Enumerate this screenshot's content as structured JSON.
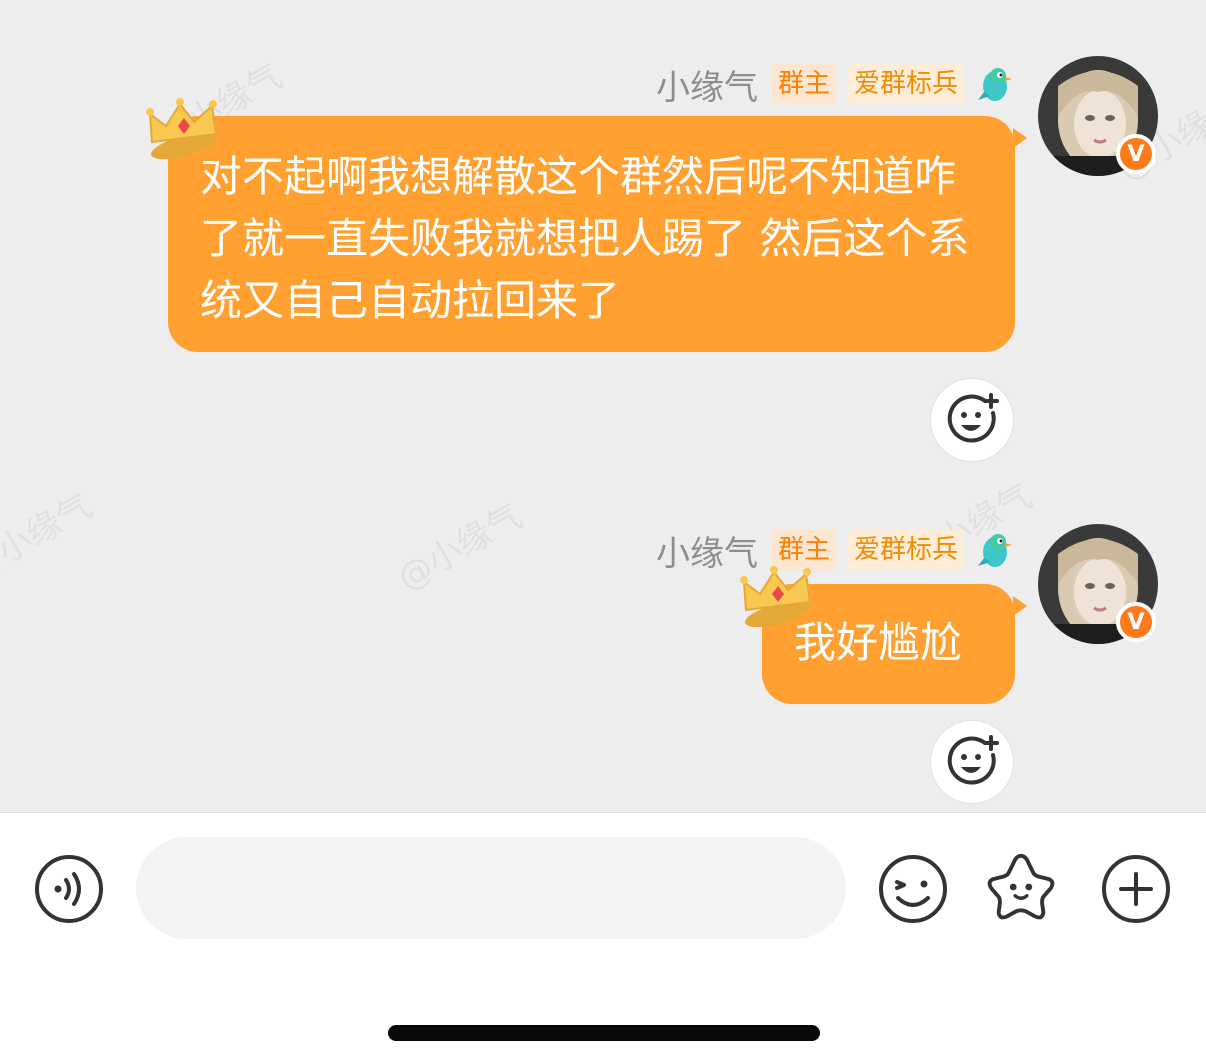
{
  "messages": [
    {
      "sender_name": "小缘气",
      "tags": [
        "群主",
        "爱群标兵"
      ],
      "text": "对不起啊我想解散这个群然后呢不知道咋了就一直失败我就想把人踢了 然后这个系统又自己自动拉回来了",
      "badge": "V"
    },
    {
      "sender_name": "小缘气",
      "tags": [
        "群主",
        "爱群标兵"
      ],
      "text": "我好尴尬",
      "badge": "V"
    }
  ],
  "watermark_text": "@小缘气",
  "input": {
    "placeholder": "",
    "value": ""
  },
  "icons": {
    "voice": "voice-icon",
    "emoji": "emoji-icon",
    "sticker": "star-sticker-icon",
    "plus": "plus-icon",
    "reaction": "add-reaction-icon",
    "crown": "crown-icon",
    "bird": "bird-badge-icon"
  },
  "colors": {
    "bubble": "#ffa031",
    "badge": "#ff7a1a",
    "tag_text": "#ff7f00",
    "background": "#ededed"
  }
}
